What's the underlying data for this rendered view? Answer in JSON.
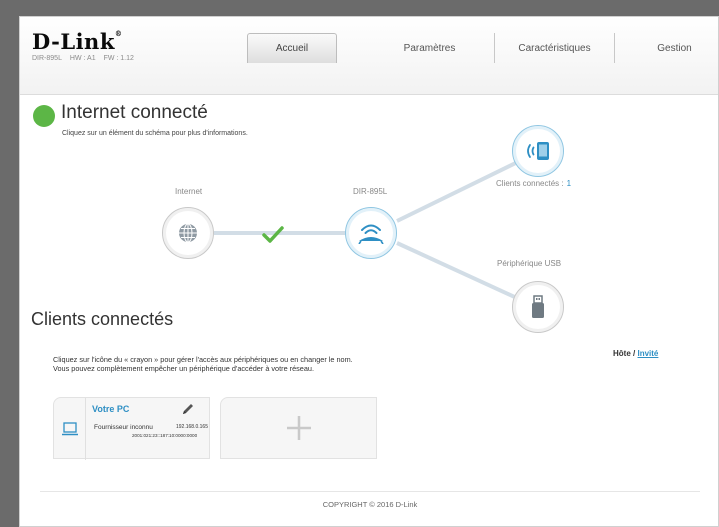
{
  "brand": {
    "logo": "D-Link",
    "logo_sup": "®"
  },
  "device": {
    "model": "DIR-895L",
    "hw": "HW : A1",
    "fw": "FW : 1.12"
  },
  "tabs": [
    {
      "label": "Accueil",
      "active": true
    },
    {
      "label": "Paramètres"
    },
    {
      "label": "Caractéristiques"
    },
    {
      "label": "Gestion"
    }
  ],
  "status": {
    "title": "Internet connecté",
    "subtitle": "Cliquez sur un élément du schéma pour plus d'informations.",
    "color": "#5cb646"
  },
  "diagram": {
    "internet_label": "Internet",
    "router_label": "DIR-895L",
    "clients_label": "Clients connectés :",
    "clients_count": "1",
    "usb_label": "Périphérique USB",
    "check_color": "#5cb646",
    "accent_color": "#2e8fc4",
    "icons": [
      "globe-icon",
      "router-icon",
      "wifi-device-icon",
      "usb-drive-icon",
      "check-icon"
    ]
  },
  "clients_section": {
    "title": "Clients connectés",
    "line1": "Cliquez sur l'icône du « crayon » pour gérer l'accès aux périphériques ou en changer le nom.",
    "line2": "Vous pouvez complètement empêcher un périphérique d'accéder à votre réseau.",
    "host_label": "Hôte",
    "separator": "/",
    "guest_label": "Invité",
    "cards": [
      {
        "name": "Votre PC",
        "vendor": "Fournisseur inconnu",
        "ip": "192.168.0.165",
        "mac": "2001:021:23::187:10:0000:0000",
        "icon": "laptop-icon"
      }
    ]
  },
  "footer": {
    "copyright": "COPYRIGHT © 2016 D-Link"
  }
}
